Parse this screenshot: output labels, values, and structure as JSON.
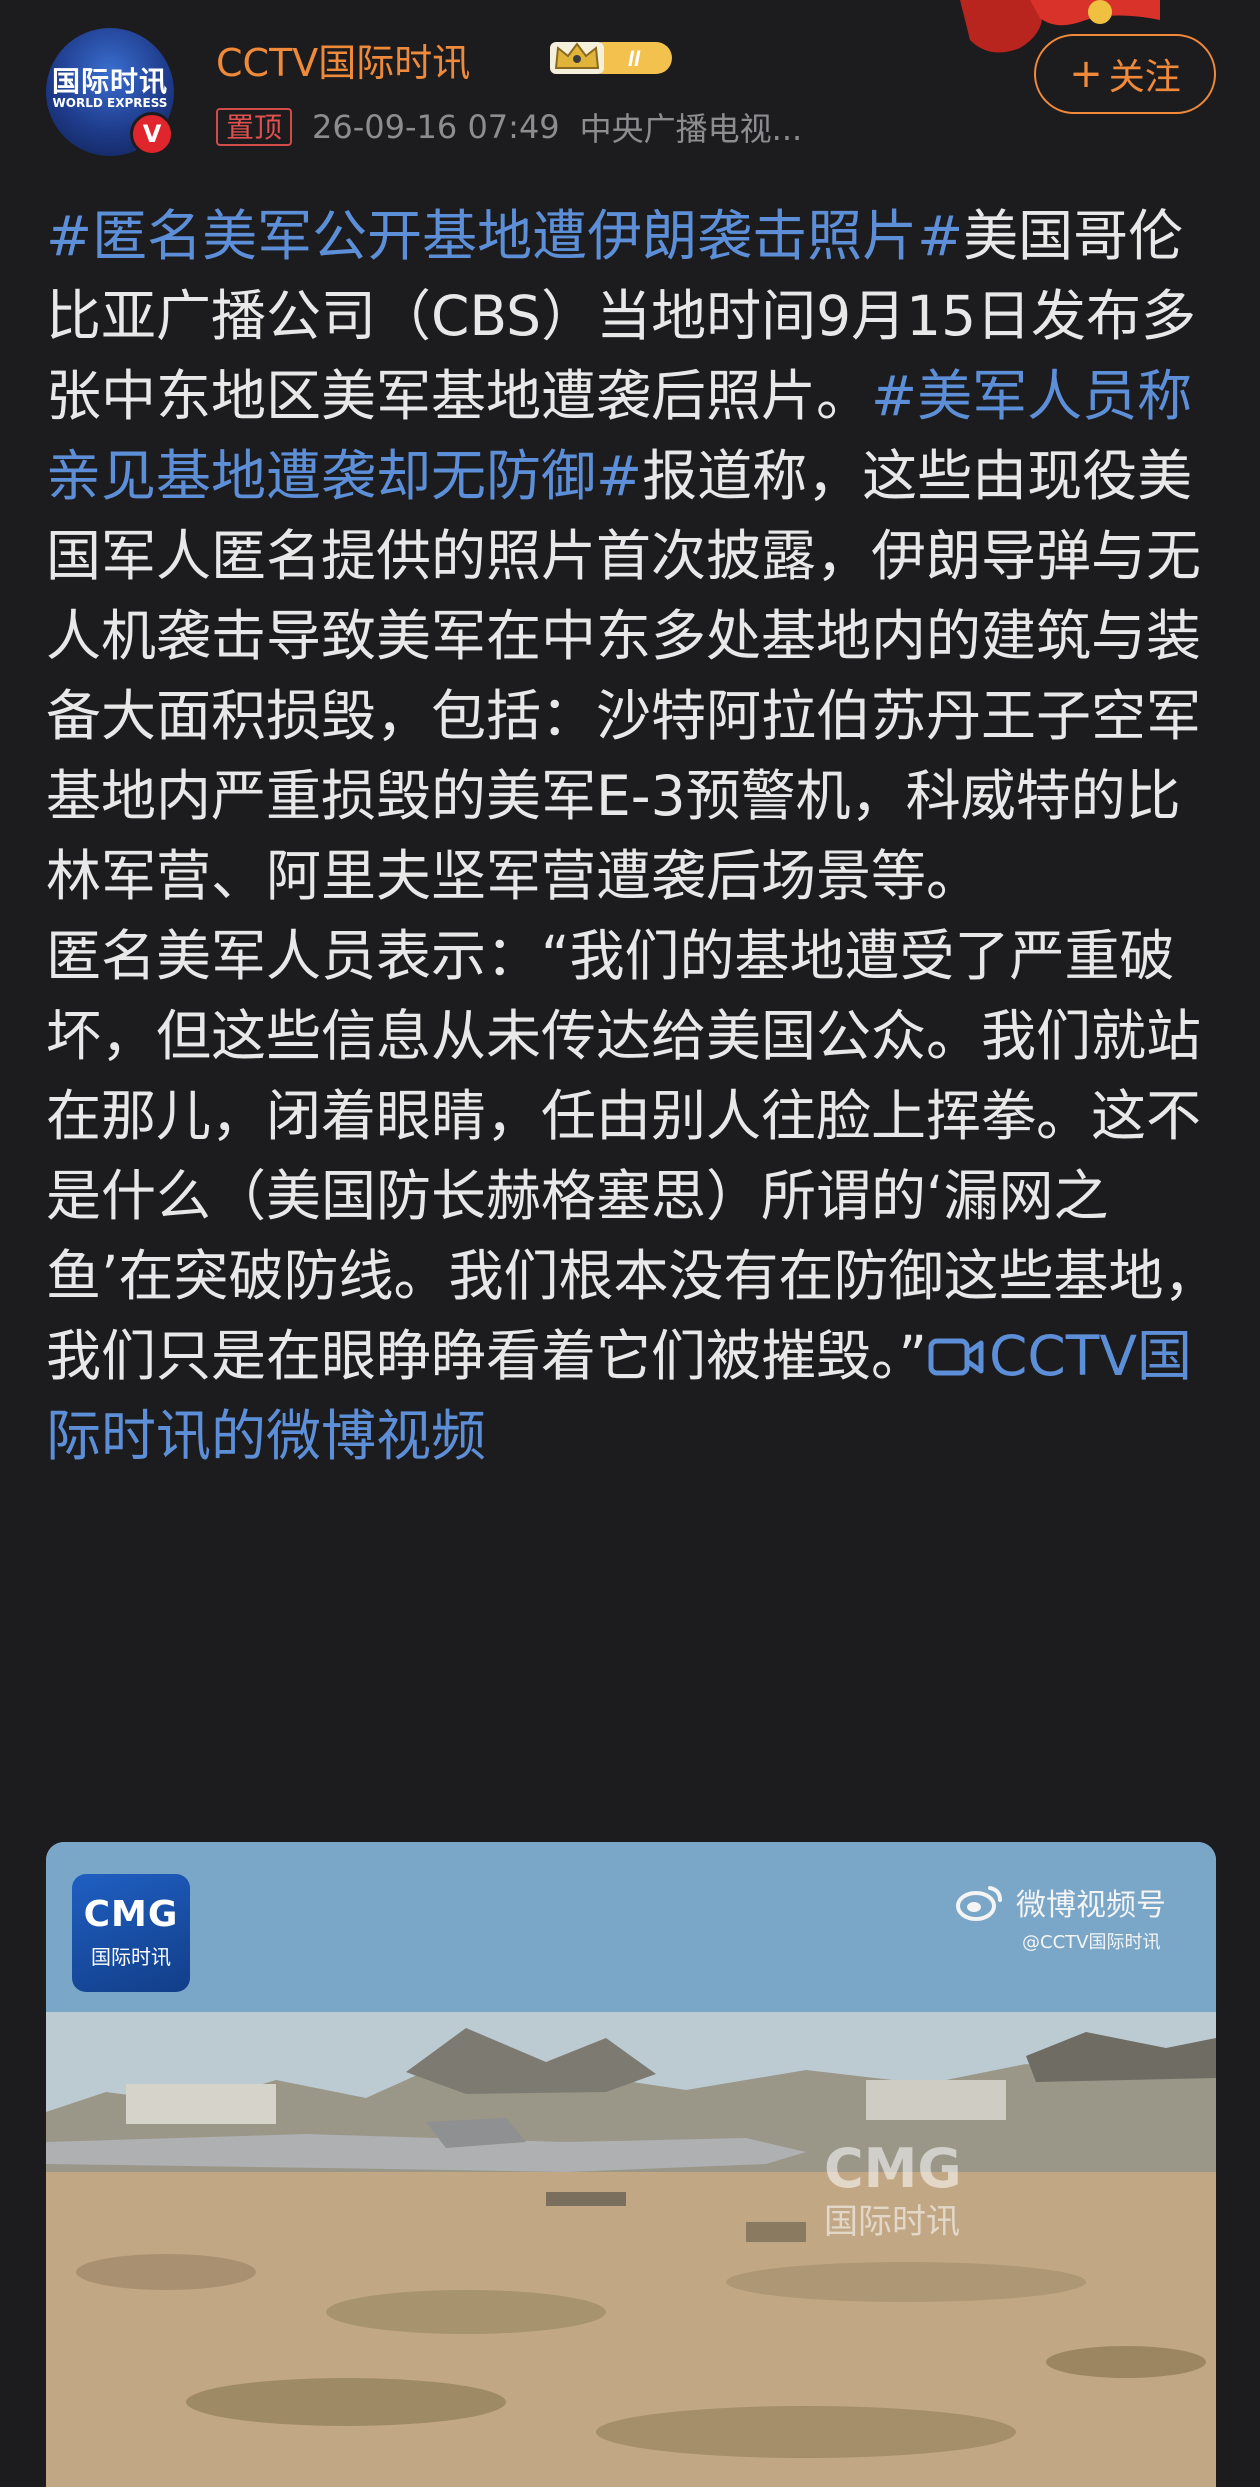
{
  "header": {
    "avatar_line1": "国际时讯",
    "avatar_line2": "WORLD EXPRESS",
    "verified_mark": "V",
    "username": "CCTV国际时讯",
    "level": "II",
    "pinned_label": "置顶",
    "timestamp": "26-09-16 07:49",
    "source": "中央广播电视...",
    "follow_plus": "+",
    "follow_label": "关注"
  },
  "post": {
    "tag1": "#匿名美军公开基地遭伊朗袭击照片#",
    "text1": "美国哥伦比亚广播公司（CBS）当地时间9月15日发布多张中东地区美军基地遭袭后照片。",
    "tag2": "#美军人员称亲见基地遭袭却无防御#",
    "text2": "报道称，这些由现役美国军人匿名提供的照片首次披露，伊朗导弹与无人机袭击导致美军在中东多处基地内的建筑与装备大面积损毁，包括：沙特阿拉伯苏丹王子空军基地内严重损毁的美军E-3预警机，科威特的比林军营、阿里夫坚军营遭袭后场景等。",
    "text3": "匿名美军人员表示：“我们的基地遭受了严重破坏，但这些信息从未传达给美国公众。我们就站在那儿，闭着眼睛，任由别人往脸上挥拳。这不是什么（美国防长赫格塞思）所谓的‘漏网之鱼’在突破防线。我们根本没有在防御这些基地，我们只是在眼睁睁看着它们被摧毁。”",
    "video_link": "CCTV国际时讯的微博视频"
  },
  "video": {
    "cmg_logo": "CMG",
    "cmg_sub": "国际时讯",
    "watermark": "微博视频号",
    "watermark_handle": "@CCTV国际时讯",
    "overlay_logo": "CMG",
    "overlay_sub": "国际时讯"
  },
  "colors": {
    "background": "#1c1c1e",
    "username": "#ef8a3a",
    "hashtag": "#5d8fd8",
    "follow": "#f08a3a",
    "pinned": "#e0504f"
  },
  "icons": [
    "verified-icon",
    "level-crown-icon",
    "video-link-icon",
    "weibo-logo-icon"
  ]
}
